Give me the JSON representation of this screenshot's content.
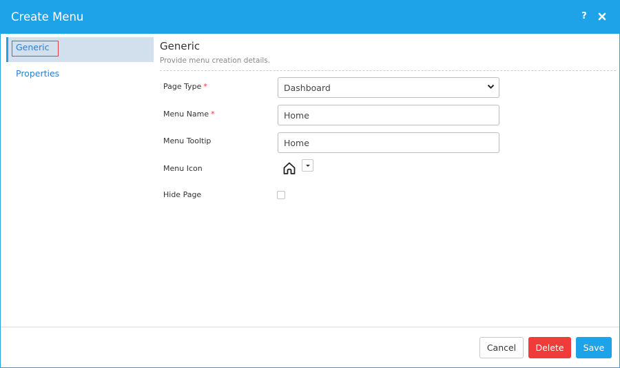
{
  "dialog": {
    "title": "Create Menu",
    "help_label": "?"
  },
  "sidebar": {
    "items": [
      {
        "label": "Generic",
        "active": true
      },
      {
        "label": "Properties",
        "active": false
      }
    ]
  },
  "section": {
    "title": "Generic",
    "subtitle": "Provide menu creation details."
  },
  "form": {
    "page_type": {
      "label": "Page Type",
      "required_mark": "*",
      "value": "Dashboard"
    },
    "menu_name": {
      "label": "Menu Name",
      "required_mark": "*",
      "value": "Home"
    },
    "menu_tooltip": {
      "label": "Menu Tooltip",
      "value": "Home"
    },
    "menu_icon": {
      "label": "Menu Icon",
      "icon": "home-icon"
    },
    "hide_page": {
      "label": "Hide Page",
      "checked": false
    }
  },
  "footer": {
    "cancel_label": "Cancel",
    "delete_label": "Delete",
    "save_label": "Save"
  },
  "colors": {
    "header": "#1ea3e8",
    "active_item_bg": "#d2e0ee",
    "delete": "#f03b3b",
    "save": "#1ea3e8",
    "required": "#e53935"
  }
}
